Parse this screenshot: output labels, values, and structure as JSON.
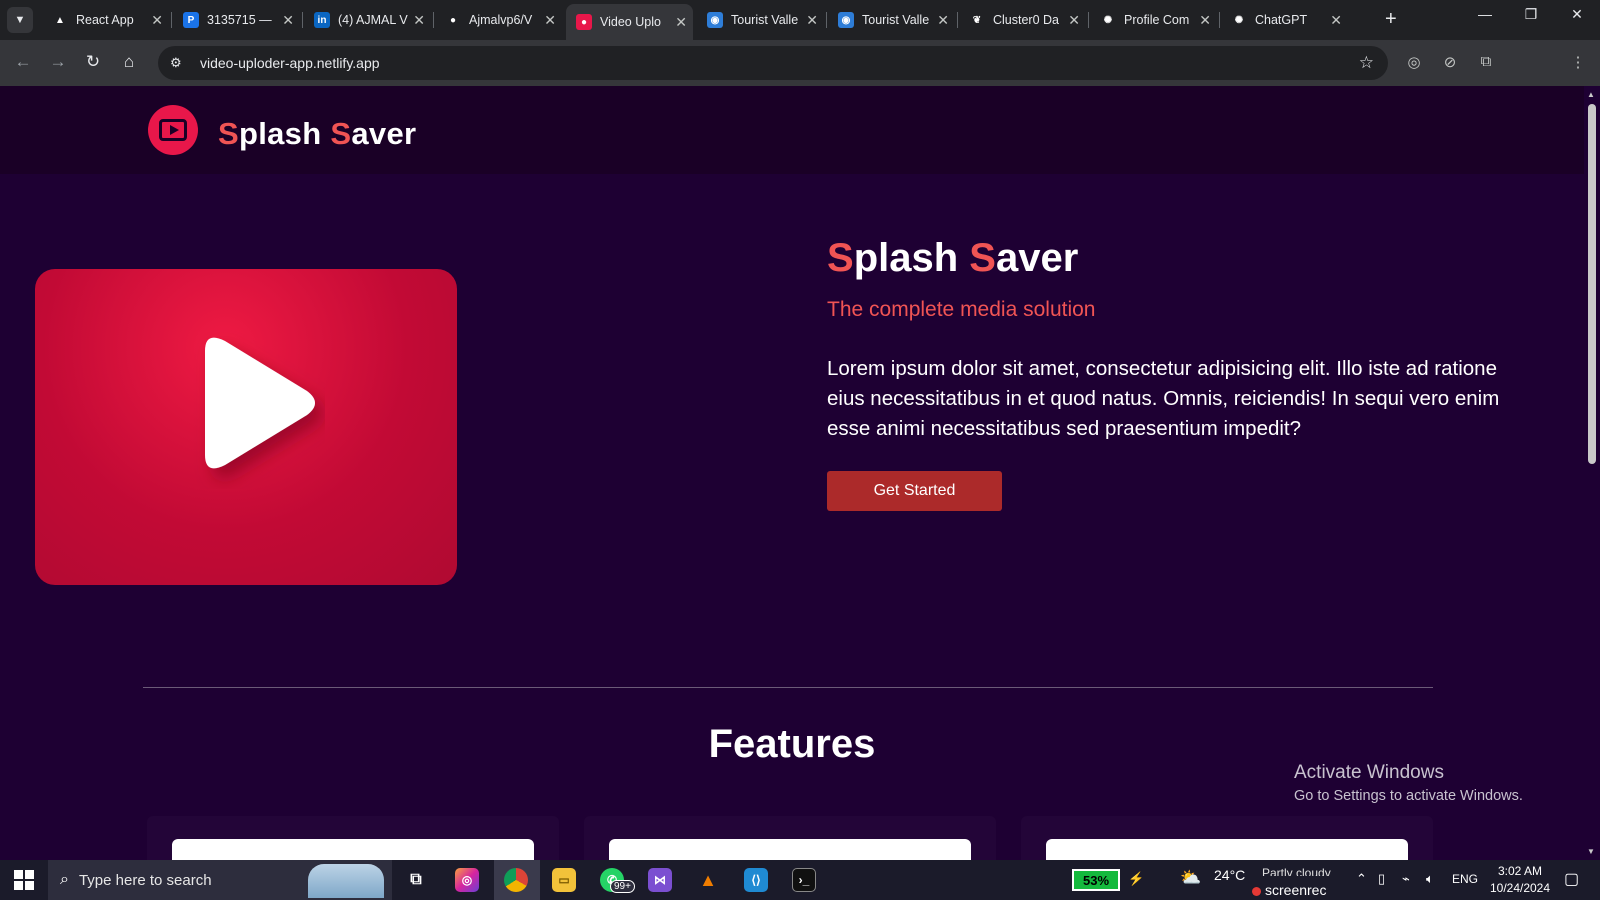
{
  "browser": {
    "tabs": [
      {
        "title": "React App",
        "favicon": "triangle-icon",
        "color": "#202124",
        "glyph": "▲"
      },
      {
        "title": "3135715 —",
        "favicon": "p-logo-icon",
        "color": "#1a73e8",
        "glyph": "P"
      },
      {
        "title": "(4) AJMAL V",
        "favicon": "linkedin-icon",
        "color": "#0a66c2",
        "glyph": "in"
      },
      {
        "title": "Ajmalvp6/V",
        "favicon": "github-icon",
        "color": "#202124",
        "glyph": "●"
      },
      {
        "title": "Video Uplo",
        "favicon": "video-app-icon",
        "color": "#e8174a",
        "glyph": "●"
      },
      {
        "title": "Tourist Valle",
        "favicon": "globe-icon",
        "color": "#2e7dd7",
        "glyph": "◉"
      },
      {
        "title": "Tourist Valle",
        "favicon": "globe-icon",
        "color": "#2e7dd7",
        "glyph": "◉"
      },
      {
        "title": "Cluster0 Da",
        "favicon": "mongodb-leaf-icon",
        "color": "#202124",
        "glyph": "❦"
      },
      {
        "title": "Profile Com",
        "favicon": "openai-icon",
        "color": "#202124",
        "glyph": "✺"
      },
      {
        "title": "ChatGPT",
        "favicon": "openai-icon",
        "color": "#202124",
        "glyph": "✺"
      }
    ],
    "active_tab_index": 4,
    "url": "video-uploder-app.netlify.app"
  },
  "site": {
    "brand_first": "S",
    "brand_rest1": "plash ",
    "brand_second": "S",
    "brand_rest2": "aver",
    "hero": {
      "subtitle": "The complete media solution",
      "body": "Lorem ipsum dolor sit amet, consectetur adipisicing elit. Illo iste ad ratione eius necessitatibus in et quod natus. Omnis, reiciendis! In sequi vero enim esse animi necessitatibus sed praesentium impedit?",
      "cta_label": "Get Started"
    },
    "features_title": "Features"
  },
  "watermark": {
    "title": "Activate Windows",
    "subtitle": "Go to Settings to activate Windows."
  },
  "taskbar": {
    "search_placeholder": "Type here to search",
    "whatsapp_badge": "99+",
    "battery": "53%",
    "temperature": "24°C",
    "weather": "Partly cloudy",
    "recorder": "screenrec",
    "language": "ENG",
    "time": "3:02 AM",
    "date": "10/24/2024"
  },
  "colors": {
    "page_bg": "#1e0033",
    "header_bg": "#1a0026",
    "accent": "#f05454",
    "button": "#ac2a2a",
    "video_red": "#e8174a"
  }
}
